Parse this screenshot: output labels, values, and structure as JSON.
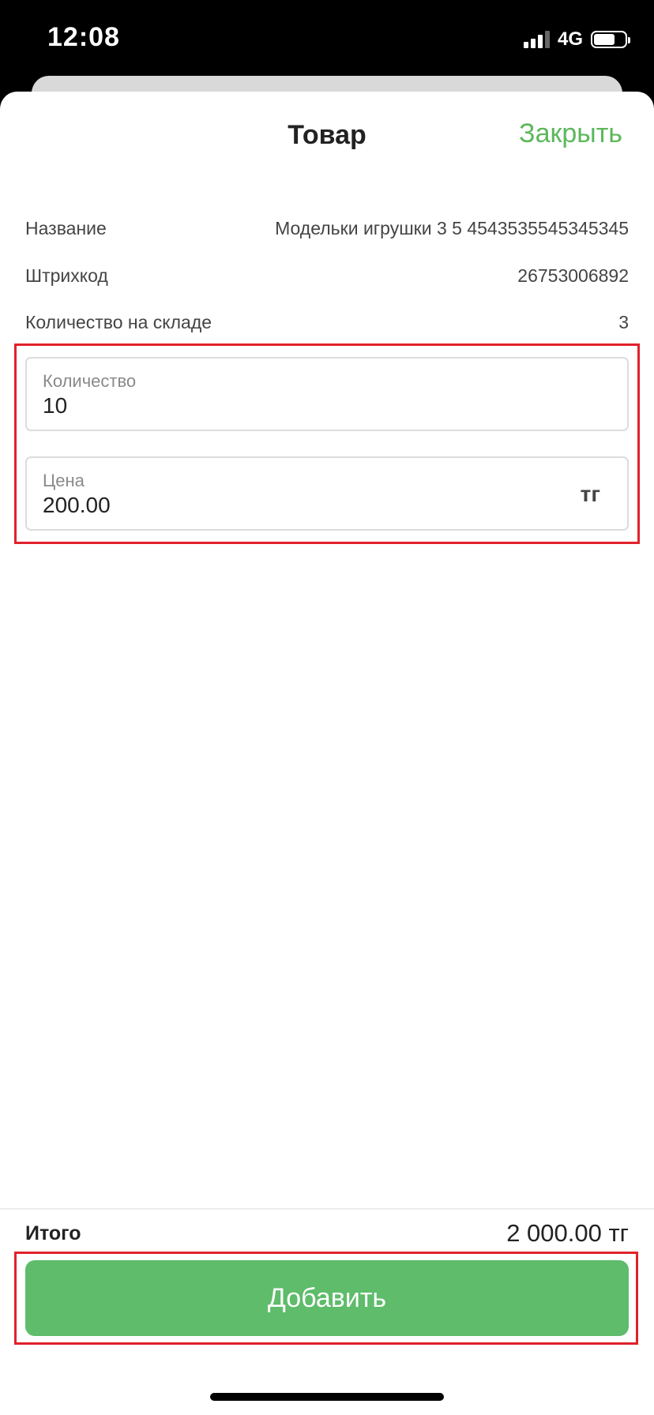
{
  "status_bar": {
    "time": "12:08",
    "network": "4G",
    "icons": [
      "signal-icon",
      "battery-icon"
    ]
  },
  "sheet": {
    "title": "Товар",
    "close_label": "Закрыть"
  },
  "info": {
    "name_label": "Название",
    "name_value": "Модельки игрушки 3 5 4543535545345345",
    "barcode_label": "Штрихкод",
    "barcode_value": "26753006892",
    "stock_label": "Количество на складе",
    "stock_value": "3"
  },
  "form": {
    "quantity_label": "Количество",
    "quantity_value": "10",
    "price_label": "Цена",
    "price_value": "200.00",
    "price_currency": "тг"
  },
  "footer": {
    "total_label": "Итого",
    "total_value": "2 000.00 тг",
    "add_label": "Добавить"
  },
  "colors": {
    "accent": "#5ebc6a",
    "highlight": "#e0222b"
  }
}
